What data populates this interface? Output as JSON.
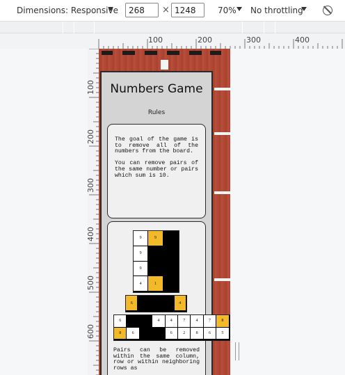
{
  "toolbar": {
    "dimensions_label": "Dimensions: Responsive",
    "width_value": "268",
    "height_value": "1248",
    "times_sign": "×",
    "zoom_label": "70%",
    "throttle_label": "No throttling",
    "rotate_icon": "rotate-icon"
  },
  "ruler": {
    "h_labels": [
      "100",
      "200",
      "300",
      "400"
    ],
    "v_labels": [
      "100",
      "200",
      "300",
      "400",
      "500",
      "600"
    ]
  },
  "page": {
    "title": "Numbers Game",
    "subtitle": "Rules",
    "rule_text_1": "The goal of the game is to remove all of the numbers from the board.\n\nYou can remove pairs of the same number or pairs which sum is 10.",
    "rule_text_2": "Pairs can be removed within the same column, row or within neighboring rows as"
  },
  "boards": {
    "column_grid": [
      [
        {
          "v": "9",
          "c": "white"
        },
        {
          "v": "9",
          "c": "yellow"
        },
        {
          "v": "",
          "c": "black"
        }
      ],
      [
        {
          "v": "9",
          "c": "white"
        },
        {
          "v": "",
          "c": "black"
        },
        {
          "v": "",
          "c": "black"
        }
      ],
      [
        {
          "v": "9",
          "c": "white"
        },
        {
          "v": "",
          "c": "black"
        },
        {
          "v": "",
          "c": "black"
        }
      ],
      [
        {
          "v": "4",
          "c": "white"
        },
        {
          "v": "1",
          "c": "yellow"
        },
        {
          "v": "",
          "c": "black"
        }
      ]
    ],
    "row_strip": [
      {
        "v": "6",
        "c": "yellow"
      },
      {
        "v": "",
        "c": "black"
      },
      {
        "v": "",
        "c": "black"
      },
      {
        "v": "",
        "c": "black"
      },
      {
        "v": "4",
        "c": "yellow"
      }
    ],
    "wide_grid": [
      [
        {
          "v": "6",
          "c": "white"
        },
        {
          "v": "",
          "c": "black"
        },
        {
          "v": "",
          "c": "black"
        },
        {
          "v": "4",
          "c": "white"
        },
        {
          "v": "4",
          "c": "white"
        },
        {
          "v": "7",
          "c": "white"
        },
        {
          "v": "4",
          "c": "white"
        },
        {
          "v": "7",
          "c": "white"
        },
        {
          "v": "8",
          "c": "yellow"
        }
      ],
      [
        {
          "v": "8",
          "c": "yellow"
        },
        {
          "v": "6",
          "c": "white"
        },
        {
          "v": "",
          "c": "black"
        },
        {
          "v": "",
          "c": "black"
        },
        {
          "v": "6",
          "c": "white"
        },
        {
          "v": "2",
          "c": "white"
        },
        {
          "v": "8",
          "c": "white"
        },
        {
          "v": "6",
          "c": "white"
        },
        {
          "v": "5",
          "c": "white"
        }
      ]
    ]
  },
  "colors": {
    "accent_yellow": "#f2b928",
    "track_red": "#b24a36",
    "panel_gray": "#d4d4d4"
  }
}
